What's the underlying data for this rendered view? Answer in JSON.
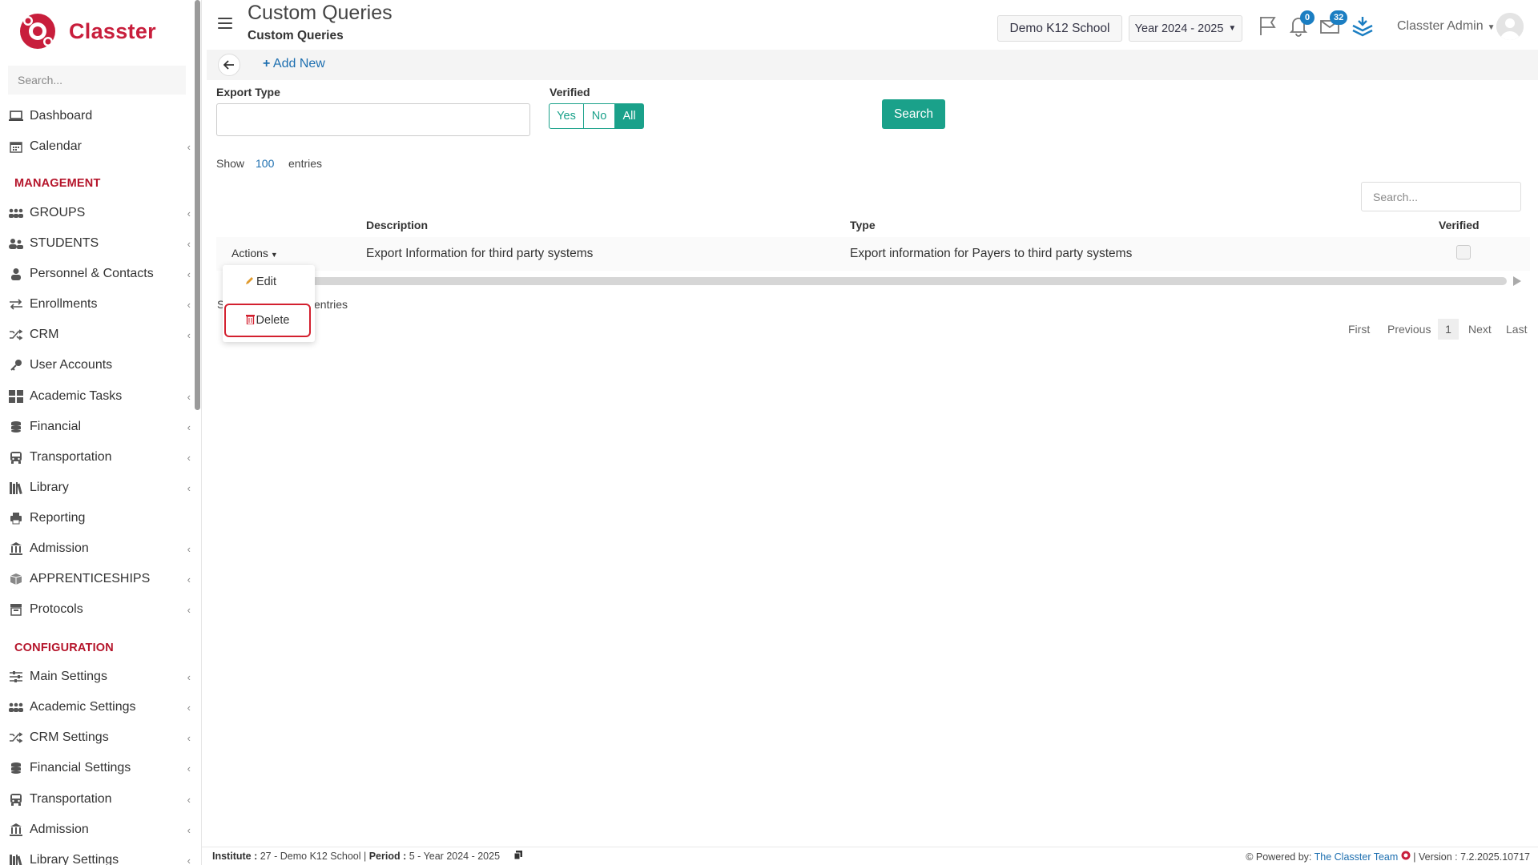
{
  "app": {
    "brand": "Classter",
    "sidebar_search_placeholder": "Search..."
  },
  "sidebar": {
    "top_items": [
      {
        "label": "Dashboard",
        "icon": "laptop-icon"
      },
      {
        "label": "Calendar",
        "icon": "calendar-icon"
      }
    ],
    "management_title": "MANAGEMENT",
    "management_items": [
      {
        "label": "GROUPS",
        "icon": "groups-icon"
      },
      {
        "label": "STUDENTS",
        "icon": "students-icon"
      },
      {
        "label": "Personnel & Contacts",
        "icon": "person-icon"
      },
      {
        "label": "Enrollments",
        "icon": "exchange-icon"
      },
      {
        "label": "CRM",
        "icon": "shuffle-icon"
      },
      {
        "label": "User Accounts",
        "icon": "key-icon"
      },
      {
        "label": "Academic Tasks",
        "icon": "grid-icon"
      },
      {
        "label": "Financial",
        "icon": "coins-icon"
      },
      {
        "label": "Transportation",
        "icon": "bus-icon"
      },
      {
        "label": "Library",
        "icon": "books-icon"
      },
      {
        "label": "Reporting",
        "icon": "print-icon"
      },
      {
        "label": "Admission",
        "icon": "institution-icon"
      },
      {
        "label": "APPRENTICESHIPS",
        "icon": "box-icon"
      },
      {
        "label": "Protocols",
        "icon": "archive-icon"
      }
    ],
    "configuration_title": "CONFIGURATION",
    "configuration_items": [
      {
        "label": "Main Settings",
        "icon": "sliders-icon"
      },
      {
        "label": "Academic Settings",
        "icon": "groups-icon"
      },
      {
        "label": "CRM Settings",
        "icon": "shuffle-icon"
      },
      {
        "label": "Financial Settings",
        "icon": "coins-icon"
      },
      {
        "label": "Transportation",
        "icon": "bus-icon"
      },
      {
        "label": "Admission",
        "icon": "institution-icon"
      },
      {
        "label": "Library Settings",
        "icon": "books-icon"
      }
    ]
  },
  "header": {
    "title": "Custom Queries",
    "subtitle": "Custom Queries",
    "school": "Demo K12 School",
    "year": "Year 2024 - 2025",
    "notifications_count": "0",
    "messages_count": "32",
    "user": "Classter Admin"
  },
  "toolbar": {
    "add_new": "Add New"
  },
  "filters": {
    "export_type_label": "Export Type",
    "export_type_value": "",
    "verified_label": "Verified",
    "verified_options": [
      "Yes",
      "No",
      "All"
    ],
    "verified_selected": "All",
    "search_button": "Search"
  },
  "table": {
    "show_label": "Show",
    "page_size": "100",
    "entries_label": "entries",
    "search_placeholder": "Search...",
    "columns": [
      "Description",
      "Type",
      "Verified"
    ],
    "rows": [
      {
        "actions": "Actions",
        "description": "Export Information for third party systems",
        "type": "Export information for Payers to third party systems",
        "verified": false
      }
    ],
    "info_prefix": "S",
    "info_suffix": "entries",
    "action_menu": [
      "Edit",
      "Delete"
    ]
  },
  "pagination": {
    "first": "First",
    "previous": "Previous",
    "current": "1",
    "next": "Next",
    "last": "Last"
  },
  "footer": {
    "institute_label": "Institute :",
    "institute_value": "27 - Demo K12 School",
    "period_label": "Period :",
    "period_value": "5 - Year 2024 - 2025",
    "powered_by": "Powered by:",
    "team": "The Classter Team",
    "version": "| Version : 7.2.2025.10717"
  },
  "colors": {
    "brand_red": "#c81e3c",
    "accent_teal": "#1aa18a",
    "link_blue": "#1d6fb0",
    "badge_blue": "#1b7ec2",
    "highlight_red": "#d3202f"
  }
}
